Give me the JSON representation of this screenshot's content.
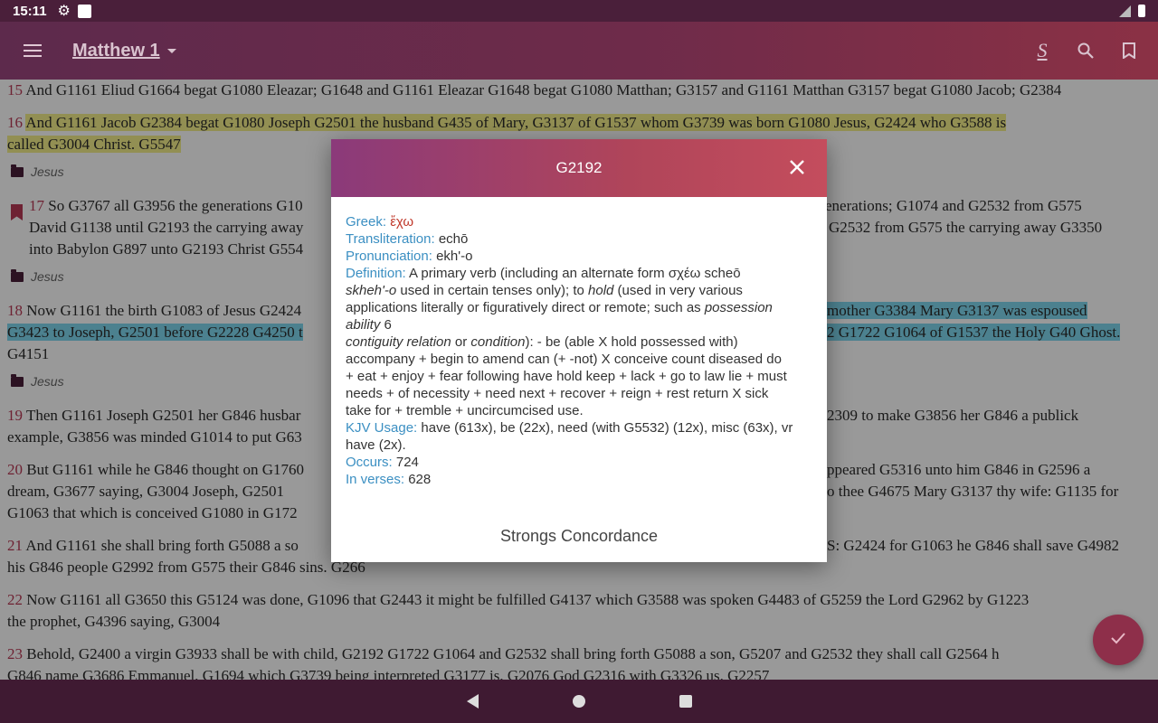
{
  "status_bar": {
    "time": "15:11"
  },
  "app_bar": {
    "title": "Matthew 1",
    "strongs_icon_label": "S"
  },
  "verses": {
    "v15": {
      "num": "15",
      "text": "And G1161 Eliud G1664 begat G1080 Eleazar; G1648 and G1161 Eleazar G1648 begat G1080 Matthan; G3157 and G1161 Matthan G3157 begat G1080 Jacob; G2384"
    },
    "v16a": {
      "num": "16",
      "text": "And G1161 Jacob G2384 begat G1080 Joseph G2501 the husband G435 of Mary, G3137 of G1537 whom G3739 was born G1080 Jesus, G2424 who G3588 is"
    },
    "v16b": {
      "text": "called G3004 Christ. G5547"
    },
    "label_jesus_1": "Jesus",
    "v17a_left": {
      "num": "17",
      "text": "So G3767 all G3956 the generations G10"
    },
    "v17a_right": "enerations; G1074 and G2532 from G575",
    "v17b_left": "David G1138 until G2193 the carrying away",
    "v17b_right": "G2532 from G575 the carrying away G3350",
    "v17c_left": "into Babylon G897 unto G2193 Christ G554",
    "label_jesus_2": "Jesus",
    "v18a_left": {
      "num": "18",
      "text": "Now G1161 the birth G1083 of Jesus G2424"
    },
    "v18a_right": "mother G3384 Mary G3137 was espoused",
    "v18b_left": "G3423 to Joseph, G2501 before G2228 G4250 t",
    "v18b_right": "2 G1722 G1064 of G1537 the Holy G40 Ghost.",
    "v18c": "G4151",
    "label_jesus_3": "Jesus",
    "v19a_left": {
      "num": "19",
      "text": "Then G1161 Joseph G2501 her G846 husbar"
    },
    "v19a_right": "2309 to make G3856 her G846 a publick",
    "v19b_left": "example, G3856 was minded G1014 to put G63",
    "v20a_left": {
      "num": "20",
      "text": "But G1161 while he G846 thought on G1760"
    },
    "v20a_right": "ppeared G5316 unto him G846 in G2596 a",
    "v20b_left": "dream, G3677 saying, G3004 Joseph, G2501",
    "v20b_right": "o thee G4675 Mary G3137 thy wife: G1135 for",
    "v20c_left": "G1063 that which is conceived G1080 in G172",
    "v21a_left": {
      "num": "21",
      "text": "And G1161 she shall bring forth G5088 a so"
    },
    "v21a_right": "S: G2424 for G1063 he G846 shall save G4982",
    "v21b": "his G846 people G2992 from G575 their G846 sins. G266",
    "v22a": {
      "num": "22",
      "text": "Now G1161 all G3650 this G5124 was done, G1096 that G2443 it might be fulfilled G4137 which G3588 was spoken G4483 of G5259 the Lord G2962 by G1223"
    },
    "v22b": "the prophet, G4396 saying, G3004",
    "v23a": {
      "num": "23",
      "text": "Behold, G2400 a virgin G3933 shall be with child, G2192 G1722 G1064 and G2532 shall bring forth G5088 a son, G5207 and G2532 they shall call G2564 h"
    },
    "v23b": "G846 name G3686 Emmanuel, G1694 which G3739 being interpreted G3177 is, G2076 God G2316 with G3326 us. G2257"
  },
  "dialog": {
    "title": "G2192",
    "greek_label": "Greek:",
    "greek_value": "ἔχω",
    "translit_label": "Transliteration:",
    "translit_value": "echō",
    "pron_label": "Pronunciation:",
    "pron_value": "ekh'-o",
    "def_label": "Definition:",
    "def_1": "A primary verb (including an alternate form σχέω scheō",
    "def_2a": "skheh'-o",
    "def_2b": " used in certain tenses only); to ",
    "def_2c": "hold",
    "def_2d": " (used in very various",
    "def_3a": "applications literally or figuratively direct or remote; such as ",
    "def_3b": "possession",
    "def_4a": "ability",
    "def_4b": " 6",
    "def_5a": "contiguity relation",
    "def_5b": " or ",
    "def_5c": "condition",
    "def_5d": "): - be (able X hold possessed with)",
    "def_6": "accompany + begin to amend can (+ -not) X conceive count diseased do",
    "def_7": "+ eat + enjoy + fear following have hold keep + lack + go to law lie + must",
    "def_8": "needs + of necessity + need next + recover + reign + rest return X sick",
    "def_9": "take for + tremble + uncircumcised use.",
    "kjv_label": "KJV Usage:",
    "kjv_value": "have (613x), be (22x), need (with G5532) (12x), misc (63x), vr",
    "kjv_value_2": "have (2x).",
    "occurs_label": "Occurs:",
    "occurs_value": "724",
    "verses_label": "In verses:",
    "verses_value": "628",
    "footer": "Strongs Concordance"
  },
  "icons": {
    "menu": "menu-icon",
    "caret": "chevron-down-icon",
    "strongs": "strongs-toggle-icon",
    "search": "search-icon",
    "bookmark": "bookmark-icon",
    "close": "close-icon",
    "check": "check-icon",
    "settings": "gear-icon"
  },
  "colors": {
    "accent": "#8e2f4a",
    "verse_number": "#b83a55",
    "dialog_key": "#3b8fc2",
    "greek": "#c0392b"
  }
}
